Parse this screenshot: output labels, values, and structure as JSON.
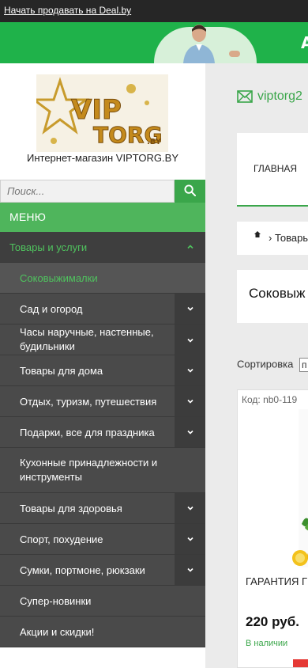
{
  "topbar": {
    "link_text": "Начать продавать на Deal.by"
  },
  "banner": {
    "partial_text": "А"
  },
  "sidebar": {
    "store_name": "Интернет-магазин VIPTORG.BY",
    "logo_text": "VIP TORG .BY",
    "search": {
      "placeholder": "Поиск..."
    },
    "menu_title": "МЕНЮ",
    "menu": [
      {
        "label": "Товары и услуги",
        "type": "category",
        "expanded": true
      },
      {
        "label": "Соковыжималки",
        "type": "active"
      },
      {
        "label": "Сад и огород",
        "type": "sub",
        "has_children": true
      },
      {
        "label": "Часы наручные, настенные, будильники",
        "type": "sub",
        "has_children": true
      },
      {
        "label": "Товары для дома",
        "type": "sub",
        "has_children": true
      },
      {
        "label": "Отдых, туризм, путешествия",
        "type": "sub",
        "has_children": true
      },
      {
        "label": "Подарки, все для праздника",
        "type": "sub",
        "has_children": true
      },
      {
        "label": "Кухонные принадлежности и инструменты",
        "type": "sub",
        "has_children": false
      },
      {
        "label": "Товары для здоровья",
        "type": "sub",
        "has_children": true
      },
      {
        "label": "Спорт, похудение",
        "type": "sub",
        "has_children": true
      },
      {
        "label": "Сумки, портмоне, рюкзаки",
        "type": "sub",
        "has_children": true
      },
      {
        "label": "Супер-новинки",
        "type": "sub",
        "has_children": false
      },
      {
        "label": "Акции и скидки!",
        "type": "sub",
        "has_children": false
      }
    ]
  },
  "content": {
    "email": "viptorg2",
    "nav_main": "ГЛАВНАЯ",
    "breadcrumb": "› Товары",
    "page_title": "Соковыж",
    "sort_label": "Сортировка",
    "sort_value": "п",
    "product": {
      "code": "Код: nb0-119",
      "name": "ГАРАНТИЯ Г центробежн",
      "price": "220 руб.",
      "stock": "В наличии"
    }
  },
  "colors": {
    "accent_green": "#3aa64a",
    "menu_header": "#4fb55c",
    "menu_bg": "#4a4a4a",
    "topbar": "#262626",
    "banner": "#1fb24a"
  }
}
